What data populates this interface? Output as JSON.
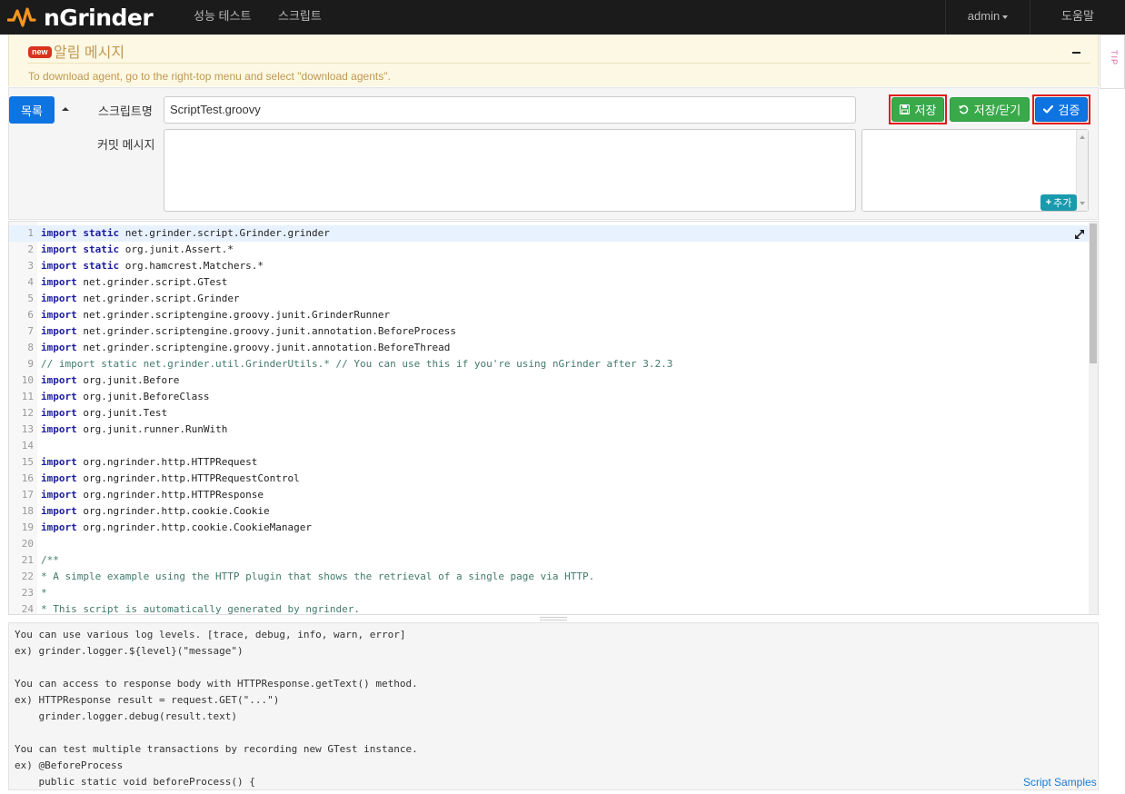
{
  "navbar": {
    "brand": "nGrinder",
    "items": [
      "성능 테스트",
      "스크립트"
    ],
    "user": "admin",
    "help": "도움말"
  },
  "notice": {
    "badge": "new",
    "title": "알림 메시지",
    "text": "To download agent, go to the right-top menu and select \"download agents\".",
    "tip_tab": "TIP"
  },
  "form": {
    "list_button": "목록",
    "script_name_label": "스크립트명",
    "script_name_value": "ScriptTest.groovy",
    "commit_label": "커밋 메시지",
    "commit_value": "",
    "save_button": "저장",
    "save_close_button": "저장/닫기",
    "validate_button": "검증",
    "add_button": "추가"
  },
  "editor": {
    "lines": [
      {
        "n": "1",
        "kw": "import static",
        "rest": " net.grinder.script.Grinder.grinder",
        "type": "import"
      },
      {
        "n": "2",
        "kw": "import static",
        "rest": " org.junit.Assert.*",
        "type": "import"
      },
      {
        "n": "3",
        "kw": "import static",
        "rest": " org.hamcrest.Matchers.*",
        "type": "import"
      },
      {
        "n": "4",
        "kw": "import",
        "rest": " net.grinder.script.GTest",
        "type": "import"
      },
      {
        "n": "5",
        "kw": "import",
        "rest": " net.grinder.script.Grinder",
        "type": "import"
      },
      {
        "n": "6",
        "kw": "import",
        "rest": " net.grinder.scriptengine.groovy.junit.GrinderRunner",
        "type": "import"
      },
      {
        "n": "7",
        "kw": "import",
        "rest": " net.grinder.scriptengine.groovy.junit.annotation.BeforeProcess",
        "type": "import"
      },
      {
        "n": "8",
        "kw": "import",
        "rest": " net.grinder.scriptengine.groovy.junit.annotation.BeforeThread",
        "type": "import"
      },
      {
        "n": "9",
        "kw": "",
        "rest": "// import static net.grinder.util.GrinderUtils.* // You can use this if you're using nGrinder after 3.2.3",
        "type": "comment"
      },
      {
        "n": "10",
        "kw": "import",
        "rest": " org.junit.Before",
        "type": "import"
      },
      {
        "n": "11",
        "kw": "import",
        "rest": " org.junit.BeforeClass",
        "type": "import"
      },
      {
        "n": "12",
        "kw": "import",
        "rest": " org.junit.Test",
        "type": "import"
      },
      {
        "n": "13",
        "kw": "import",
        "rest": " org.junit.runner.RunWith",
        "type": "import"
      },
      {
        "n": "14",
        "kw": "",
        "rest": "",
        "type": "blank"
      },
      {
        "n": "15",
        "kw": "import",
        "rest": " org.ngrinder.http.HTTPRequest",
        "type": "import"
      },
      {
        "n": "16",
        "kw": "import",
        "rest": " org.ngrinder.http.HTTPRequestControl",
        "type": "import"
      },
      {
        "n": "17",
        "kw": "import",
        "rest": " org.ngrinder.http.HTTPResponse",
        "type": "import"
      },
      {
        "n": "18",
        "kw": "import",
        "rest": " org.ngrinder.http.cookie.Cookie",
        "type": "import"
      },
      {
        "n": "19",
        "kw": "import",
        "rest": " org.ngrinder.http.cookie.CookieManager",
        "type": "import"
      },
      {
        "n": "20",
        "kw": "",
        "rest": "",
        "type": "blank"
      },
      {
        "n": "21",
        "kw": "",
        "rest": "/**",
        "type": "comment"
      },
      {
        "n": "22",
        "kw": "",
        "rest": "* A simple example using the HTTP plugin that shows the retrieval of a single page via HTTP.",
        "type": "comment"
      },
      {
        "n": "23",
        "kw": "",
        "rest": "*",
        "type": "comment"
      },
      {
        "n": "24",
        "kw": "",
        "rest": "* This script is automatically generated by ngrinder.",
        "type": "comment"
      }
    ]
  },
  "tips": {
    "lines": [
      "You can use various log levels. [trace, debug, info, warn, error]",
      "ex) grinder.logger.${level}(\"message\")",
      "",
      "You can access to response body with HTTPResponse.getText() method.",
      "ex) HTTPResponse result = request.GET(\"...\")",
      "    grinder.logger.debug(result.text)",
      "",
      "You can test multiple transactions by recording new GTest instance.",
      "ex) @BeforeProcess",
      "    public static void beforeProcess() {"
    ],
    "samples_link": "Script Samples"
  }
}
